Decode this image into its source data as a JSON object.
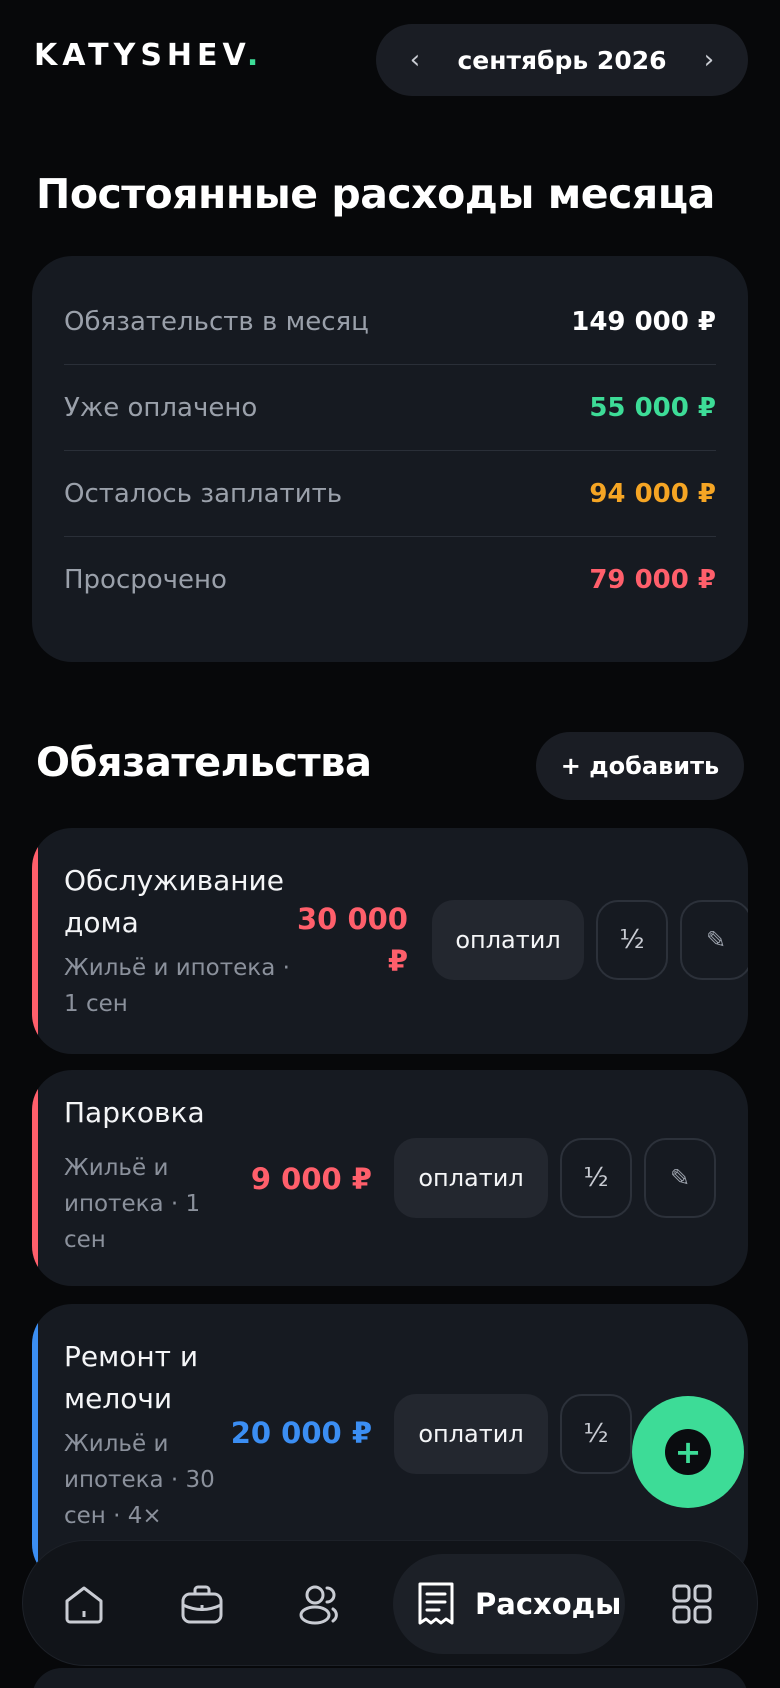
{
  "header": {
    "logo": "KATYSHEV",
    "logo_dot": ".",
    "month": "сентябрь 2026",
    "prev": "‹",
    "next": "›"
  },
  "title": "Постоянные расходы месяца",
  "summary": [
    {
      "label": "Обязательств в месяц",
      "value": "149 000 ₽",
      "color": "#ffffff"
    },
    {
      "label": "Уже оплачено",
      "value": "55 000 ₽",
      "color": "#3ddc97"
    },
    {
      "label": "Осталось заплатить",
      "value": "94 000 ₽",
      "color": "#f5a524"
    },
    {
      "label": "Просрочено",
      "value": "79 000 ₽",
      "color": "#ff5f6b"
    }
  ],
  "obligations_section": {
    "heading": "Обязательства",
    "add_label": "+ добавить"
  },
  "cards": [
    {
      "name_line1": "Обслуживание",
      "name_line2": "дома",
      "meta_line1": "Жильё и ипотека ·",
      "meta_line2": "1 сен",
      "amount_line1": "30 000",
      "amount_line2": "₽",
      "color": "#ff5f6b",
      "pay_label": "оплатил",
      "half_label": "½",
      "edit_label": "✎"
    },
    {
      "name_line1": "Парковка",
      "meta_line1": "Жильё и",
      "meta_line2": "ипотека · 1",
      "meta_line3": "сен",
      "amount": "9 000 ₽",
      "color": "#ff5f6b",
      "pay_label": "оплатил",
      "half_label": "½",
      "edit_label": "✎"
    },
    {
      "name_line1": "Ремонт и",
      "name_line2": "мелочи",
      "meta_line1": "Жильё и",
      "meta_line2": "ипотека · 30",
      "meta_line3": "сен · 4×",
      "amount": "20 000 ₽",
      "color": "#3b8ef3",
      "pay_label": "оплатил",
      "half_label": "½"
    }
  ],
  "fab": {
    "icon": "+"
  },
  "bottom_nav": {
    "active_label": "Расходы",
    "items": [
      "home-icon",
      "briefcase-icon",
      "people-icon",
      "receipt-icon",
      "grid-icon"
    ]
  },
  "colors": {
    "accent": "#3ddc97",
    "danger": "#ff5f6b",
    "warning": "#f5a524",
    "info": "#3b8ef3",
    "card": "#161a21",
    "background": "#07080a"
  }
}
